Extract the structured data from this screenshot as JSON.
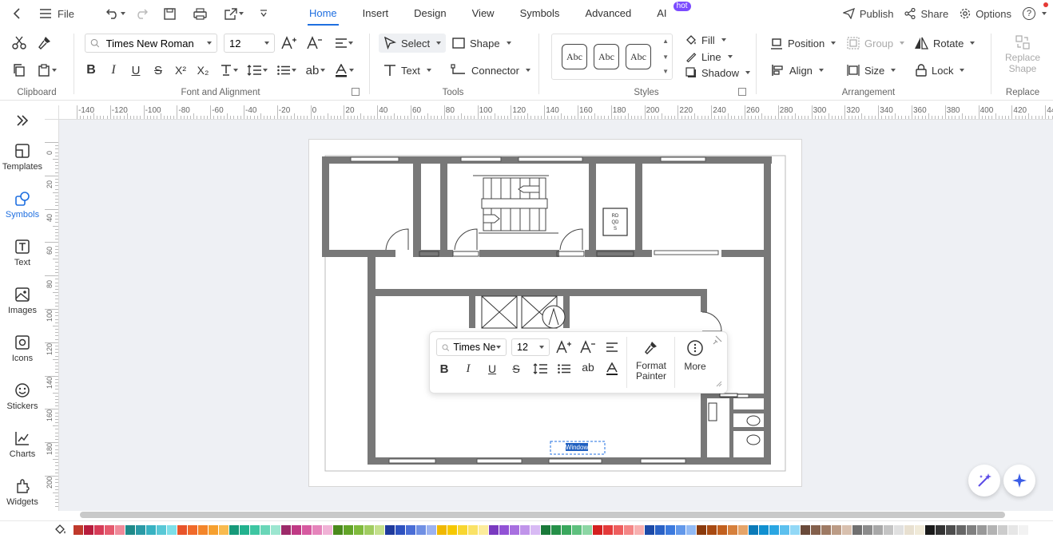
{
  "menubar": {
    "file_label": "File",
    "tabs": [
      {
        "label": "Home",
        "active": true
      },
      {
        "label": "Insert"
      },
      {
        "label": "Design"
      },
      {
        "label": "View"
      },
      {
        "label": "Symbols"
      },
      {
        "label": "Advanced"
      },
      {
        "label": "AI",
        "badge": "hot"
      }
    ],
    "publish_label": "Publish",
    "share_label": "Share",
    "options_label": "Options",
    "help_label": "?"
  },
  "ribbon": {
    "clipboard": {
      "label": "Clipboard"
    },
    "font": {
      "label": "Font and Alignment",
      "font_family": "Times New Roman",
      "font_size": "12"
    },
    "tools": {
      "label": "Tools",
      "select_label": "Select",
      "shape_label": "Shape",
      "text_label": "Text",
      "connector_label": "Connector"
    },
    "styles": {
      "label": "Styles",
      "samples": [
        "Abc",
        "Abc",
        "Abc"
      ],
      "fill_label": "Fill",
      "line_label": "Line",
      "shadow_label": "Shadow"
    },
    "arrangement": {
      "label": "Arrangement",
      "position_label": "Position",
      "group_label": "Group",
      "rotate_label": "Rotate",
      "align_label": "Align",
      "size_label": "Size",
      "lock_label": "Lock"
    },
    "replace": {
      "label": "Replace",
      "replace_shape_line1": "Replace",
      "replace_shape_line2": "Shape"
    }
  },
  "sidebar": {
    "items": [
      {
        "label": "Templates",
        "icon": "templates-icon"
      },
      {
        "label": "Symbols",
        "icon": "symbols-icon",
        "active": true
      },
      {
        "label": "Text",
        "icon": "text-icon"
      },
      {
        "label": "Images",
        "icon": "images-icon"
      },
      {
        "label": "Icons",
        "icon": "icons-icon"
      },
      {
        "label": "Stickers",
        "icon": "stickers-icon"
      },
      {
        "label": "Charts",
        "icon": "charts-icon"
      },
      {
        "label": "Widgets",
        "icon": "widgets-icon"
      }
    ]
  },
  "rulers": {
    "h_ticks": [
      "-140",
      "-120",
      "-100",
      "-80",
      "-60",
      "-40",
      "-20",
      "0",
      "20",
      "40",
      "60",
      "80",
      "100",
      "120",
      "140",
      "160",
      "180",
      "200",
      "220",
      "240",
      "260",
      "280",
      "300",
      "320",
      "340",
      "360",
      "380",
      "400",
      "420",
      "440"
    ],
    "v_ticks": [
      "0",
      "20",
      "40",
      "60",
      "80",
      "100",
      "120",
      "140",
      "160",
      "180",
      "200"
    ]
  },
  "floorplan": {
    "stair_sign_lines": [
      "RD",
      "QD",
      "S"
    ],
    "selected_text": "Window"
  },
  "floatbar": {
    "font_family": "Times Ne",
    "font_size": "12",
    "format_painter_line1": "Format",
    "format_painter_line2": "Painter",
    "more_label": "More"
  },
  "colors": {
    "accent": "#1f6fe0",
    "wall": "#787878",
    "canvas_bg": "#eef0f4",
    "palette": [
      "#c0392b",
      "#b71c3c",
      "#d63b57",
      "#e55a6e",
      "#f08a9a",
      "#1f8a8a",
      "#2a9aa6",
      "#38b2c2",
      "#59c8d6",
      "#7edfe8",
      "#e8542a",
      "#f06a2a",
      "#f3852a",
      "#f6a02f",
      "#f9bb4f",
      "#179a7a",
      "#22b28e",
      "#3ec6a2",
      "#6ad6b8",
      "#9ce6d0",
      "#9c2a6a",
      "#c03a85",
      "#d65aa0",
      "#e584bb",
      "#f0b2d6",
      "#4a8a1c",
      "#62a428",
      "#7fba3c",
      "#a0cc60",
      "#c4e08c",
      "#1f3a9c",
      "#2e52c0",
      "#4a6ed6",
      "#7090e4",
      "#9cb2f0",
      "#f0b800",
      "#f6c800",
      "#f8d630",
      "#fae266",
      "#fcec9c",
      "#7a3ac0",
      "#9252d6",
      "#a870e0",
      "#c094ea",
      "#d8baf4",
      "#1a7a3a",
      "#259048",
      "#3aa85e",
      "#5ec07e",
      "#8cd6a4",
      "#d42020",
      "#e43a3a",
      "#ee5e5e",
      "#f48686",
      "#f8b0b0",
      "#1c4aa8",
      "#2a62c6",
      "#3c7ade",
      "#6298ea",
      "#92baf4",
      "#8a3a0c",
      "#a84a12",
      "#c2601e",
      "#d6803c",
      "#e6a468",
      "#0a7ab8",
      "#1090d0",
      "#2aa6e2",
      "#5cc0ee",
      "#92d8f6",
      "#6a4a3a",
      "#84604c",
      "#9e7a64",
      "#bc9c86",
      "#d8c0ae",
      "#707070",
      "#8c8c8c",
      "#a8a8a8",
      "#c4c4c4",
      "#e0e0e0",
      "#e8e0d0",
      "#f0ead8",
      "#1a1a1a",
      "#333333",
      "#4d4d4d",
      "#666666",
      "#808080",
      "#999999",
      "#b3b3b3",
      "#cccccc",
      "#e6e6e6",
      "#f2f2f2"
    ]
  }
}
